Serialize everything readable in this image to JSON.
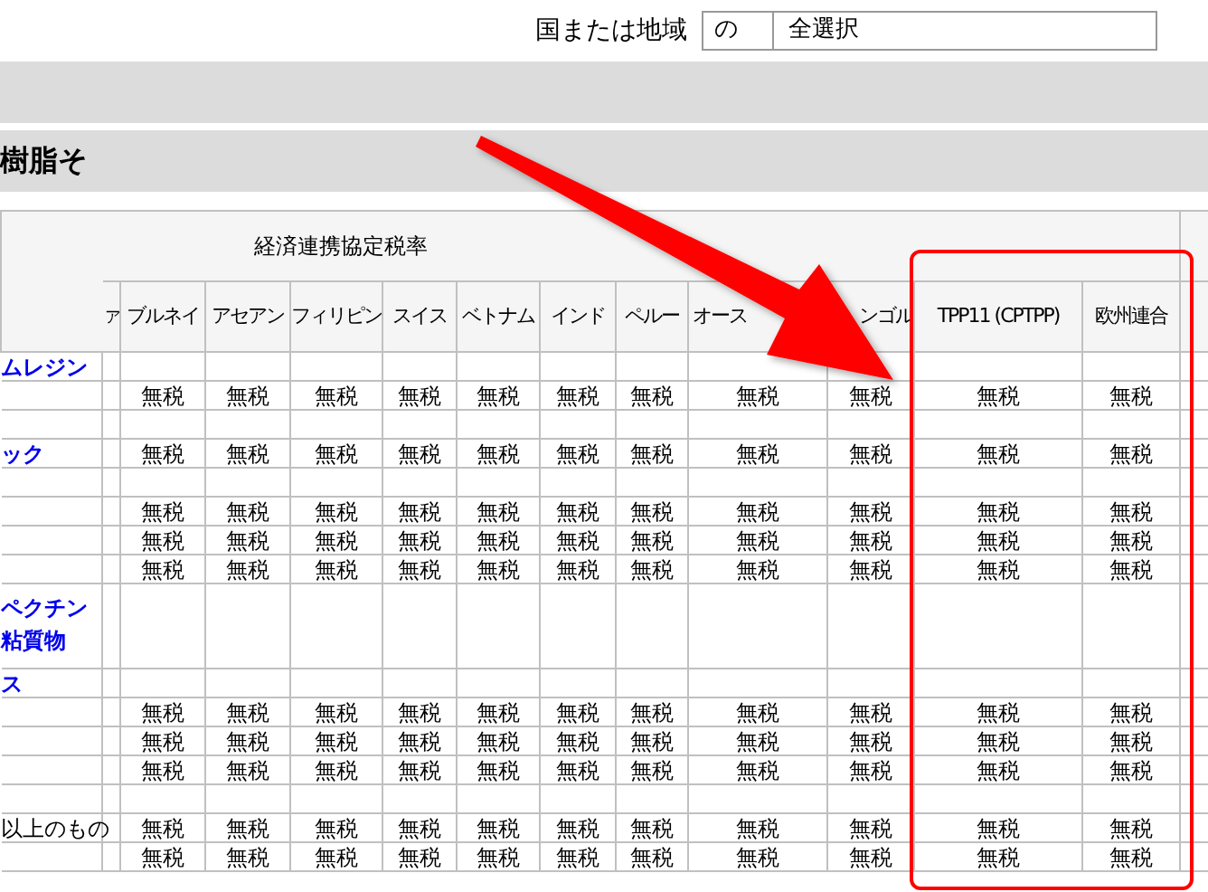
{
  "filter": {
    "label": "国または地域",
    "code": "の",
    "value": "全選択"
  },
  "section_title": "樹脂そ",
  "table": {
    "group_header": "経済連携協定税率",
    "columns": [
      {
        "label": "ア",
        "kind": "partial"
      },
      {
        "label": "ブルネイ",
        "kind": "data"
      },
      {
        "label": "アセアン",
        "kind": "data"
      },
      {
        "label": "フィリピン",
        "kind": "data"
      },
      {
        "label": "スイス",
        "kind": "data"
      },
      {
        "label": "ベトナム",
        "kind": "data"
      },
      {
        "label": "インド",
        "kind": "data"
      },
      {
        "label": "ペルー",
        "kind": "data"
      },
      {
        "label": "オース",
        "kind": "data"
      },
      {
        "label": "ンゴル",
        "kind": "data"
      },
      {
        "label": "TPP11 (CPTPP)",
        "kind": "data"
      },
      {
        "label": "欧州連合",
        "kind": "data"
      }
    ],
    "rows": [
      {
        "kind": "link",
        "label": [
          "ムレジン"
        ],
        "cells": []
      },
      {
        "cells": [
          "",
          "無税",
          "無税",
          "無税",
          "無税",
          "無税",
          "無税",
          "無税",
          "無税",
          "無税",
          "無税",
          "無税"
        ]
      },
      {
        "cells": []
      },
      {
        "kind": "link",
        "label": [
          "ック"
        ],
        "cells": [
          "",
          "無税",
          "無税",
          "無税",
          "無税",
          "無税",
          "無税",
          "無税",
          "無税",
          "無税",
          "無税",
          "無税"
        ]
      },
      {
        "cells": []
      },
      {
        "cells": [
          "",
          "無税",
          "無税",
          "無税",
          "無税",
          "無税",
          "無税",
          "無税",
          "無税",
          "無税",
          "無税",
          "無税"
        ]
      },
      {
        "cells": [
          "",
          "無税",
          "無税",
          "無税",
          "無税",
          "無税",
          "無税",
          "無税",
          "無税",
          "無税",
          "無税",
          "無税"
        ]
      },
      {
        "cells": [
          "",
          "無税",
          "無税",
          "無税",
          "無税",
          "無税",
          "無税",
          "無税",
          "無税",
          "無税",
          "無税",
          "無税"
        ]
      },
      {
        "kind": "link",
        "label": [
          "ペクチン",
          "粘質物"
        ],
        "cells": []
      },
      {
        "kind": "link",
        "label": [
          "ス"
        ],
        "cells": []
      },
      {
        "cells": [
          "",
          "無税",
          "無税",
          "無税",
          "無税",
          "無税",
          "無税",
          "無税",
          "無税",
          "無税",
          "無税",
          "無税"
        ]
      },
      {
        "cells": [
          "",
          "無税",
          "無税",
          "無税",
          "無税",
          "無税",
          "無税",
          "無税",
          "無税",
          "無税",
          "無税",
          "無税"
        ]
      },
      {
        "cells": [
          "",
          "無税",
          "無税",
          "無税",
          "無税",
          "無税",
          "無税",
          "無税",
          "無税",
          "無税",
          "無税",
          "無税"
        ]
      },
      {
        "cells": []
      },
      {
        "kind": "plain",
        "label": [
          "以上のもの"
        ],
        "cells": [
          "",
          "無税",
          "無税",
          "無税",
          "無税",
          "無税",
          "無税",
          "無税",
          "無税",
          "無税",
          "無税",
          "無税"
        ]
      },
      {
        "cells": [
          "",
          "無税",
          "無税",
          "無税",
          "無税",
          "無税",
          "無税",
          "無税",
          "無税",
          "無税",
          "無税",
          "無税"
        ]
      }
    ]
  },
  "annotations": {
    "arrow": true,
    "highlight_box": true
  }
}
